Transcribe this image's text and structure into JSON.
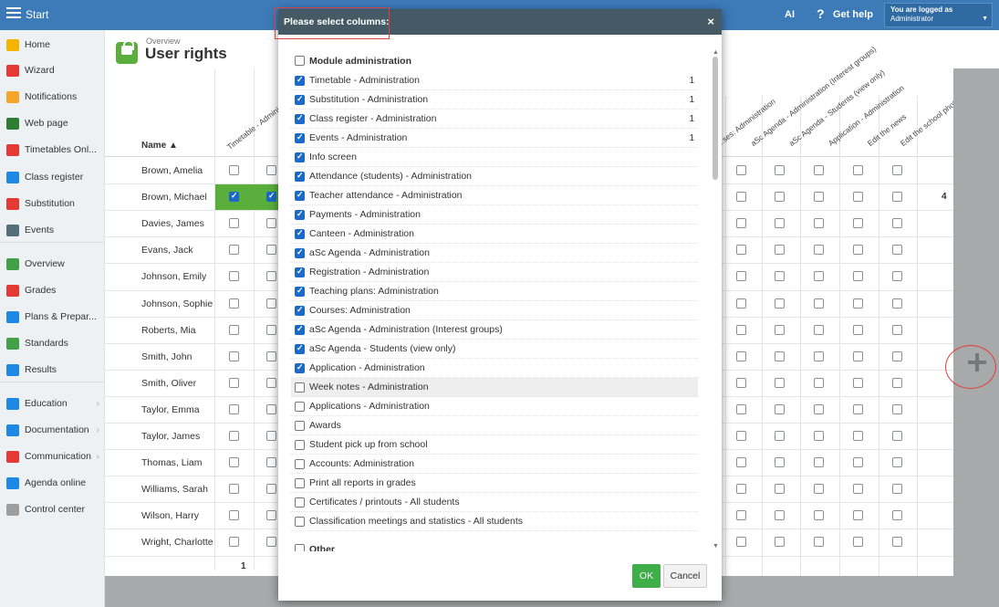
{
  "topbar": {
    "start_label": "Start",
    "ai_label": "AI",
    "help_icon": "?",
    "help_label": "Get help",
    "logged_line1": "You are logged as",
    "logged_line2": "Administrator"
  },
  "sidebar": {
    "items": [
      {
        "label": "Home",
        "icon": "star-icon",
        "color": "#f4b400"
      },
      {
        "label": "Wizard",
        "icon": "wand-icon",
        "color": "#e53935"
      },
      {
        "label": "Notifications",
        "icon": "envelope-icon",
        "color": "#f4a52a"
      },
      {
        "label": "Web page",
        "icon": "home-icon",
        "color": "#2e7d32"
      },
      {
        "label": "Timetables Onl...",
        "icon": "calendar-icon",
        "color": "#e53935"
      },
      {
        "label": "Class register",
        "icon": "book-icon",
        "color": "#1e88e5"
      },
      {
        "label": "Substitution",
        "icon": "user-icon",
        "color": "#e53935"
      },
      {
        "label": "Events",
        "icon": "calendar-grid-icon",
        "color": "#546e7a"
      },
      {
        "label": "Overview",
        "icon": "check-circle-icon",
        "color": "#43a047"
      },
      {
        "label": "Grades",
        "icon": "grades-icon",
        "color": "#e53935"
      },
      {
        "label": "Plans & Prepar...",
        "icon": "folder-icon",
        "color": "#1e88e5"
      },
      {
        "label": "Standards",
        "icon": "shield-icon",
        "color": "#43a047"
      },
      {
        "label": "Results",
        "icon": "bar-chart-icon",
        "color": "#1e88e5"
      },
      {
        "label": "Education",
        "icon": "education-icon",
        "color": "#1e88e5"
      },
      {
        "label": "Documentation",
        "icon": "document-icon",
        "color": "#1e88e5"
      },
      {
        "label": "Communication",
        "icon": "chat-icon",
        "color": "#e53935"
      },
      {
        "label": "Agenda online",
        "icon": "pencil-icon",
        "color": "#1e88e5"
      },
      {
        "label": "Control center",
        "icon": "gear-icon",
        "color": "#9e9e9e"
      }
    ],
    "collapse_icon": "‹"
  },
  "page": {
    "breadcrumb": "Overview",
    "title": "User rights"
  },
  "table": {
    "name_header": "Name ▲",
    "left_headers": [
      "Timetable - Administrat...",
      ""
    ],
    "right_headers": [
      "...ses: Administration",
      "aSc Agenda - Administration (Interest groups)",
      "aSc Agenda - Students (view only)",
      "Application - Administration",
      "Edit the news",
      "Edit the school photoalbum"
    ],
    "rows": [
      {
        "name": "Brown, Amelia",
        "checked": false,
        "count": ""
      },
      {
        "name": "Brown, Michael",
        "checked": true,
        "count": "4"
      },
      {
        "name": "Davies, James",
        "checked": false,
        "count": ""
      },
      {
        "name": "Evans, Jack",
        "checked": false,
        "count": ""
      },
      {
        "name": "Johnson, Emily",
        "checked": false,
        "count": ""
      },
      {
        "name": "Johnson, Sophie",
        "checked": false,
        "count": ""
      },
      {
        "name": "Roberts, Mia",
        "checked": false,
        "count": ""
      },
      {
        "name": "Smith, John",
        "checked": false,
        "count": ""
      },
      {
        "name": "Smith, Oliver",
        "checked": false,
        "count": ""
      },
      {
        "name": "Taylor, Emma",
        "checked": false,
        "count": ""
      },
      {
        "name": "Taylor, James",
        "checked": false,
        "count": ""
      },
      {
        "name": "Thomas, Liam",
        "checked": false,
        "count": ""
      },
      {
        "name": "Williams, Sarah",
        "checked": false,
        "count": ""
      },
      {
        "name": "Wilson, Harry",
        "checked": false,
        "count": ""
      },
      {
        "name": "Wright, Charlotte",
        "checked": false,
        "count": ""
      }
    ],
    "sum_value": "1"
  },
  "dialog": {
    "title": "Please select columns:",
    "close_icon": "×",
    "options": [
      {
        "label": "Module administration",
        "checked": false,
        "group": true,
        "count": ""
      },
      {
        "label": "Timetable - Administration",
        "checked": true,
        "count": "1"
      },
      {
        "label": "Substitution - Administration",
        "checked": true,
        "count": "1"
      },
      {
        "label": "Class register - Administration",
        "checked": true,
        "count": "1"
      },
      {
        "label": "Events - Administration",
        "checked": true,
        "count": "1"
      },
      {
        "label": "Info screen",
        "checked": true,
        "count": ""
      },
      {
        "label": "Attendance (students) - Administration",
        "checked": true,
        "count": ""
      },
      {
        "label": "Teacher attendance - Administration",
        "checked": true,
        "count": ""
      },
      {
        "label": "Payments - Administration",
        "checked": true,
        "count": ""
      },
      {
        "label": "Canteen - Administration",
        "checked": true,
        "count": ""
      },
      {
        "label": "aSc Agenda - Administration",
        "checked": true,
        "count": ""
      },
      {
        "label": "Registration - Administration",
        "checked": true,
        "count": ""
      },
      {
        "label": "Teaching plans: Administration",
        "checked": true,
        "count": ""
      },
      {
        "label": "Courses: Administration",
        "checked": true,
        "count": ""
      },
      {
        "label": "aSc Agenda - Administration (Interest groups)",
        "checked": true,
        "count": ""
      },
      {
        "label": "aSc Agenda - Students (view only)",
        "checked": true,
        "count": ""
      },
      {
        "label": "Application - Administration",
        "checked": true,
        "count": ""
      },
      {
        "label": "Week notes - Administration",
        "checked": false,
        "count": "",
        "highlight": true
      },
      {
        "label": "Applications - Administration",
        "checked": false,
        "count": ""
      },
      {
        "label": "Awards",
        "checked": false,
        "count": ""
      },
      {
        "label": "Student pick up from school",
        "checked": false,
        "count": ""
      },
      {
        "label": "Accounts: Administration",
        "checked": false,
        "count": ""
      },
      {
        "label": "Print all reports in grades",
        "checked": false,
        "count": ""
      },
      {
        "label": "Certificates / printouts - All students",
        "checked": false,
        "count": ""
      },
      {
        "label": "Classification meetings and statistics - All students",
        "checked": false,
        "count": ""
      },
      {
        "label": "Other",
        "checked": false,
        "group": true,
        "count": ""
      }
    ],
    "ok_label": "OK",
    "cancel_label": "Cancel"
  },
  "colors": {
    "topbar": "#3d7ab8",
    "dialog_header": "#455a64",
    "ok_button": "#3fae49",
    "checked": "#1b6ac9",
    "highlight_annotation": "#e0413a"
  }
}
